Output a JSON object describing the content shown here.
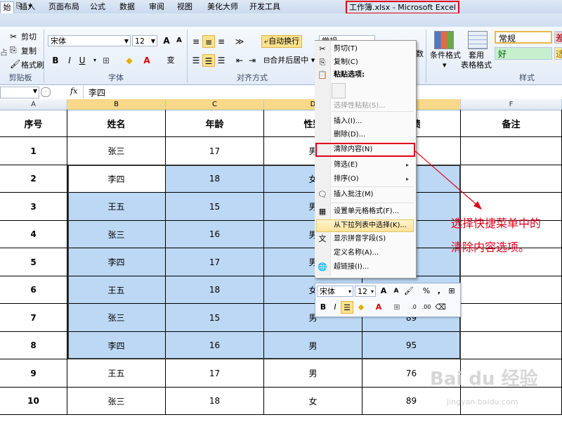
{
  "window": {
    "title": "工作簿.xlsx - Microsoft Excel",
    "accent_red": "#e0001a",
    "quick_access": [
      "A",
      "⎘",
      "▾"
    ]
  },
  "tabs": [
    "始",
    "插入",
    "页面布局",
    "公式",
    "数据",
    "审阅",
    "视图",
    "美化大师",
    "开发工具"
  ],
  "ribbon": {
    "clipboard": {
      "cut": "剪切",
      "copy": "复制",
      "format_painter": "格式刷",
      "paste_partial": "占",
      "group": "剪贴板"
    },
    "font": {
      "name": "宋体",
      "size": "12",
      "grow": "A",
      "shrink": "A",
      "bold": "B",
      "italic": "I",
      "underline": "U",
      "phonetic": "变",
      "group": "字体",
      "caret": "▾",
      "border": "⊞",
      "fill": "◆",
      "color": "A"
    },
    "alignment": {
      "wrap": "自动换行",
      "merge": "合并后居中",
      "group": "对齐方式",
      "orient": "≫"
    },
    "number": {
      "format": "常规",
      "partial": "数",
      "pct": "%",
      "comma": ","
    },
    "styles": {
      "cond_format": "条件格式",
      "table_format": "套用\n表格格式",
      "normal": "常规",
      "good": "好",
      "bad_partial": "差",
      "neutral_partial": "适",
      "group": "样式"
    }
  },
  "formula_bar": {
    "namebox": "",
    "fx": "fx",
    "value": "李四"
  },
  "columns": [
    "A",
    "B",
    "C",
    "D",
    "E",
    "F"
  ],
  "headers": [
    "序号",
    "姓名",
    "年龄",
    "性别",
    "成绩",
    "备注"
  ],
  "rows": [
    [
      "1",
      "张三",
      "17",
      "男",
      "",
      ""
    ],
    [
      "2",
      "李四",
      "18",
      "女",
      "",
      ""
    ],
    [
      "3",
      "王五",
      "15",
      "男",
      "",
      ""
    ],
    [
      "4",
      "张三",
      "16",
      "男",
      "",
      ""
    ],
    [
      "5",
      "李四",
      "17",
      "男",
      "",
      ""
    ],
    [
      "6",
      "王五",
      "18",
      "女",
      "",
      ""
    ],
    [
      "7",
      "张三",
      "15",
      "男",
      "89",
      ""
    ],
    [
      "8",
      "李四",
      "16",
      "男",
      "95",
      ""
    ],
    [
      "9",
      "王五",
      "17",
      "男",
      "76",
      ""
    ],
    [
      "10",
      "张三",
      "18",
      "女",
      "89",
      ""
    ]
  ],
  "context_menu": {
    "items": [
      {
        "label": "剪切(T)",
        "icon": "scissors-icon"
      },
      {
        "label": "复制(C)",
        "icon": "copy-icon"
      },
      {
        "label": "粘贴选项:",
        "icon": "paste-icon"
      },
      {
        "label": "选择性粘贴(S)...",
        "icon": ""
      },
      {
        "label": "插入(I)...",
        "icon": ""
      },
      {
        "label": "删除(D)...",
        "icon": ""
      },
      {
        "label": "清除内容(N)",
        "icon": ""
      },
      {
        "label": "筛选(E)",
        "icon": ""
      },
      {
        "label": "排序(O)",
        "icon": ""
      },
      {
        "label": "插入批注(M)",
        "icon": "comment-icon"
      },
      {
        "label": "设置单元格格式(F)...",
        "icon": "format-cells-icon"
      },
      {
        "label": "从下拉列表中选择(K)...",
        "icon": ""
      },
      {
        "label": "显示拼音字段(S)",
        "icon": "phonetic-icon"
      },
      {
        "label": "定义名称(A)...",
        "icon": ""
      },
      {
        "label": "超链接(I)...",
        "icon": "hyperlink-icon"
      }
    ],
    "submenu_arrow": "▸"
  },
  "mini_toolbar": {
    "font": "宋体",
    "size": "12",
    "bold": "B",
    "italic": "I",
    "pct": "%",
    "comma": ","
  },
  "annotation": {
    "line1": "选择快捷菜单中的",
    "line2": "清除内容选项。"
  },
  "watermark": {
    "main": "Bai du 经验",
    "sub": "jingyan.baidu.com"
  }
}
